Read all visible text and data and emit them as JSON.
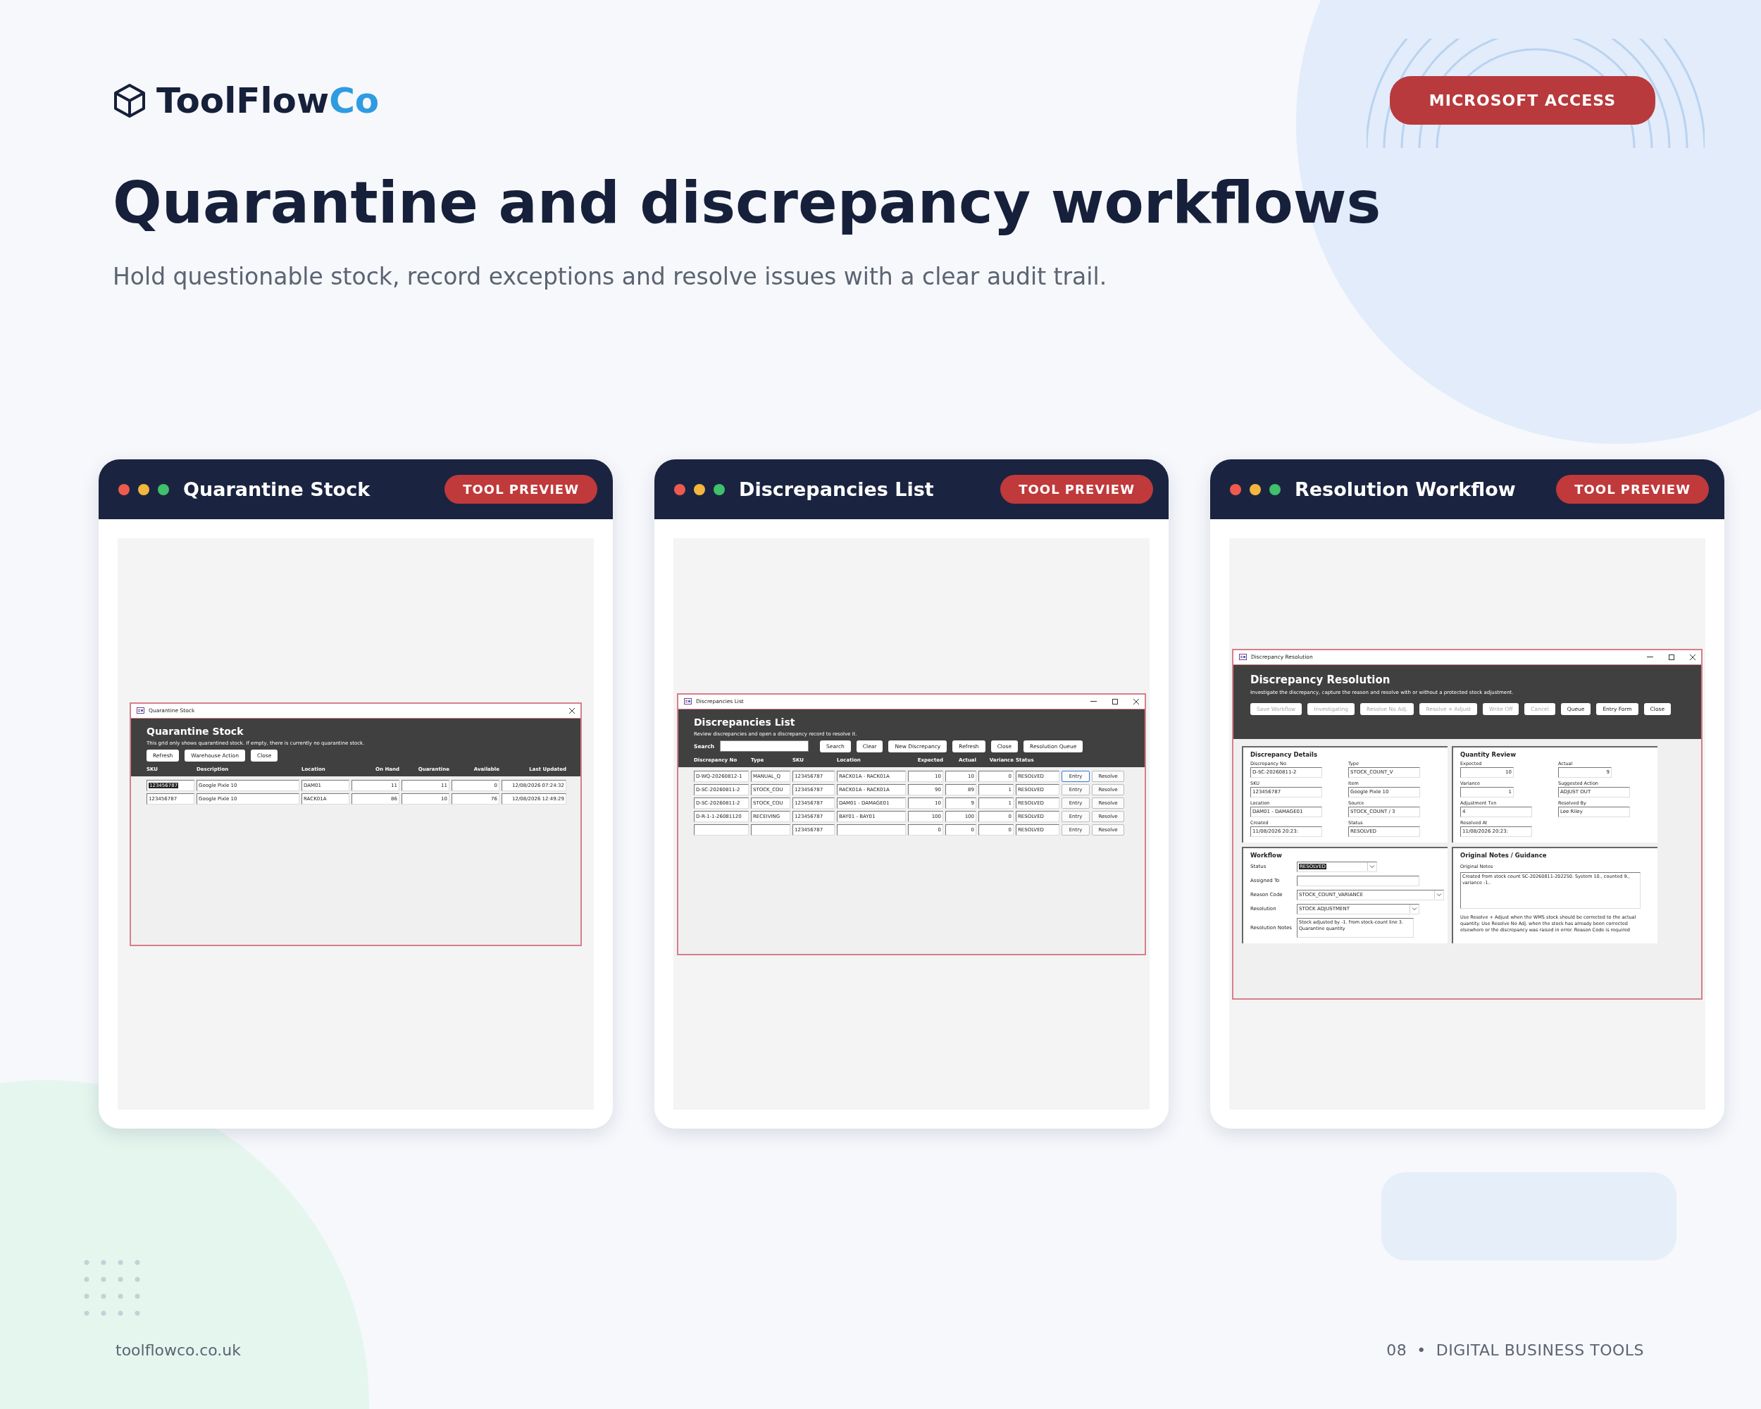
{
  "brand": {
    "name": "ToolFlow",
    "accent": "Co"
  },
  "badge": "MICROSOFT ACCESS",
  "title": "Quarantine and discrepancy workflows",
  "subtitle": "Hold questionable stock, record exceptions and resolve issues with a clear audit trail.",
  "cards": [
    {
      "title": "Quarantine Stock",
      "badge": "TOOL PREVIEW",
      "window": {
        "kind": "grid",
        "caption": "Quarantine Stock",
        "maximizable": false,
        "heading": "Quarantine Stock",
        "description": "This grid only shows quarantined stock. If empty, there is currently no quarantine stock.",
        "buttons": [
          {
            "label": "Refresh",
            "disabled": false
          },
          {
            "label": "Warehouse Action",
            "disabled": false
          },
          {
            "label": "Close",
            "disabled": false
          }
        ],
        "columns": [
          {
            "label": "SKU",
            "kind": "text"
          },
          {
            "label": "Description",
            "kind": "text"
          },
          {
            "label": "Location",
            "kind": "text"
          },
          {
            "label": "On Hand",
            "kind": "number"
          },
          {
            "label": "Quarantine",
            "kind": "number"
          },
          {
            "label": "Available",
            "kind": "number"
          },
          {
            "label": "Last Updated",
            "kind": "number"
          }
        ],
        "rows": [
          {
            "selected": true,
            "cells": [
              "123456787",
              "Google Pixle 10",
              "DAM01",
              "11",
              "11",
              "0",
              "12/08/2026 07:24:32"
            ]
          },
          {
            "selected": false,
            "cells": [
              "123456787",
              "Google Pixle 10",
              "RACK01A",
              "86",
              "10",
              "76",
              "12/08/2026 12:49:29"
            ]
          }
        ]
      }
    },
    {
      "title": "Discrepancies List",
      "badge": "TOOL PREVIEW",
      "window": {
        "kind": "list",
        "caption": "Discrepancies List",
        "maximizable": true,
        "heading": "Discrepancies List",
        "description": "Review discrepancies and open a discrepancy record to resolve it.",
        "search_label": "Search",
        "buttons": [
          {
            "label": "Search",
            "disabled": false
          },
          {
            "label": "Clear",
            "disabled": false
          },
          {
            "label": "New Discrepancy",
            "disabled": false
          },
          {
            "label": "Refresh",
            "disabled": false
          },
          {
            "label": "Close",
            "disabled": false
          },
          {
            "label": "Resolution Queue",
            "disabled": false
          }
        ],
        "columns": [
          {
            "label": "Discrepancy No",
            "kind": "text"
          },
          {
            "label": "Type",
            "kind": "text"
          },
          {
            "label": "SKU",
            "kind": "text"
          },
          {
            "label": "Location",
            "kind": "text"
          },
          {
            "label": "Expected",
            "kind": "number"
          },
          {
            "label": "Actual",
            "kind": "number"
          },
          {
            "label": "Variance",
            "kind": "number"
          },
          {
            "label": "Status",
            "kind": "text"
          }
        ],
        "rows": [
          {
            "cells": [
              "D-WQ-20260812-1",
              "MANUAL_Q",
              "123456787",
              "RACK01A - RACK01A",
              "10",
              "10",
              "0",
              "RESOLVED"
            ],
            "actions": [
              {
                "label": "Entry",
                "focused": true
              },
              {
                "label": "Resolve",
                "focused": false
              }
            ]
          },
          {
            "cells": [
              "D-SC-20260811-2",
              "STOCK_COU",
              "123456787",
              "RACK01A - RACK01A",
              "90",
              "89",
              "1",
              "RESOLVED"
            ],
            "actions": [
              {
                "label": "Entry",
                "focused": false
              },
              {
                "label": "Resolve",
                "focused": false
              }
            ]
          },
          {
            "cells": [
              "D-SC-20260811-2",
              "STOCK_COU",
              "123456787",
              "DAM01 - DAMAGE01",
              "10",
              "9",
              "1",
              "RESOLVED"
            ],
            "actions": [
              {
                "label": "Entry",
                "focused": false
              },
              {
                "label": "Resolve",
                "focused": false
              }
            ]
          },
          {
            "cells": [
              "D-R-1-1-26081120",
              "RECEIVING",
              "123456787",
              "BAY01 - BAY01",
              "100",
              "100",
              "0",
              "RESOLVED"
            ],
            "actions": [
              {
                "label": "Entry",
                "focused": false
              },
              {
                "label": "Resolve",
                "focused": false
              }
            ]
          },
          {
            "cells": [
              null,
              null,
              "123456787",
              null,
              "0",
              "0",
              "0",
              "RESOLVED"
            ],
            "actions": [
              {
                "label": "Entry",
                "focused": false
              },
              {
                "label": "Resolve",
                "focused": false
              }
            ]
          }
        ]
      }
    },
    {
      "title": "Resolution Workflow",
      "badge": "TOOL PREVIEW",
      "window": {
        "kind": "form",
        "caption": "Discrepancy Resolution",
        "maximizable": true,
        "heading": "Discrepancy Resolution",
        "description": "Investigate the discrepancy, capture the reason and resolve with or without a protected stock adjustment.",
        "buttons": [
          {
            "label": "Save Workflow",
            "disabled": true
          },
          {
            "label": "Investigating",
            "disabled": true
          },
          {
            "label": "Resolve No Adj.",
            "disabled": true
          },
          {
            "label": "Resolve + Adjust",
            "disabled": true
          },
          {
            "label": "Write Off",
            "disabled": true
          },
          {
            "label": "Cancel",
            "disabled": true
          },
          {
            "label": "Queue",
            "disabled": false
          },
          {
            "label": "Entry Form",
            "disabled": false
          },
          {
            "label": "Close",
            "disabled": false
          }
        ],
        "panels": [
          {
            "kind": "pairs",
            "title": "Discrepancy Details",
            "fields": [
              {
                "label": "Discrepancy No",
                "kind": "text",
                "value": "D-SC-20260811-2"
              },
              {
                "label": "Type",
                "kind": "text",
                "value": "STOCK_COUNT_V"
              },
              {
                "label": "SKU",
                "kind": "text",
                "value": "123456787"
              },
              {
                "label": "Item",
                "kind": "text",
                "value": "Google Pixle 10"
              },
              {
                "label": "Location",
                "kind": "text",
                "value": "DAM01 - DAMAGE01"
              },
              {
                "label": "Source",
                "kind": "text",
                "value": "STOCK_COUNT / 3"
              },
              {
                "label": "Created",
                "kind": "text",
                "value": "11/08/2026 20:23:"
              },
              {
                "label": "Status",
                "kind": "text",
                "value": "RESOLVED"
              }
            ]
          },
          {
            "kind": "pairs",
            "title": "Quantity Review",
            "fields": [
              {
                "label": "Expected",
                "kind": "number",
                "value": "10"
              },
              {
                "label": "Actual",
                "kind": "number",
                "value": "9"
              },
              {
                "label": "Variance",
                "kind": "number",
                "value": "1"
              },
              {
                "label": "Suggested Action",
                "kind": "text",
                "value": "ADJUST OUT"
              },
              {
                "label": "Adjustment Txn",
                "kind": "text",
                "value": "4"
              },
              {
                "label": "Resolved By",
                "kind": "text",
                "value": "Lee Riley"
              },
              {
                "label": "Resolved At",
                "kind": "text",
                "value": "11/08/2026 20:23:"
              }
            ]
          },
          {
            "kind": "rows",
            "title": "Workflow",
            "fields": [
              {
                "label": "Status",
                "kind": "dropdown",
                "value": "RESOLVED",
                "selected": true
              },
              {
                "label": "Assigned To",
                "kind": "text",
                "selected": false
              },
              {
                "label": "Reason Code",
                "kind": "dropdown",
                "value": "STOCK_COUNT_VARIANCE",
                "selected": false
              },
              {
                "label": "Resolution",
                "kind": "dropdown",
                "value": "STOCK ADJUSTMENT",
                "selected": false
              },
              {
                "label": "Resolution Notes",
                "kind": "memo",
                "value": "Stock adjusted by -1. from stock-count line 3. Quarantine quantity",
                "selected": false
              }
            ]
          },
          {
            "kind": "notes",
            "title": "Original Notes / Guidance",
            "label": "Original Notes",
            "notes": "Created from stock count SC-20260811-202250. System 10., counted 9., variance -1..",
            "guidance": "Use Resolve + Adjust when the WMS stock should be corrected to the actual quantity. Use Resolve No Adj. when the stock has already been corrected elsewhere or the discrepancy was raised in error. Reason Code is required"
          }
        ]
      }
    }
  ],
  "footer": {
    "site": "toolflowco.co.uk",
    "page": "08",
    "separator": "•",
    "section": "DIGITAL BUSINESS TOOLS"
  }
}
